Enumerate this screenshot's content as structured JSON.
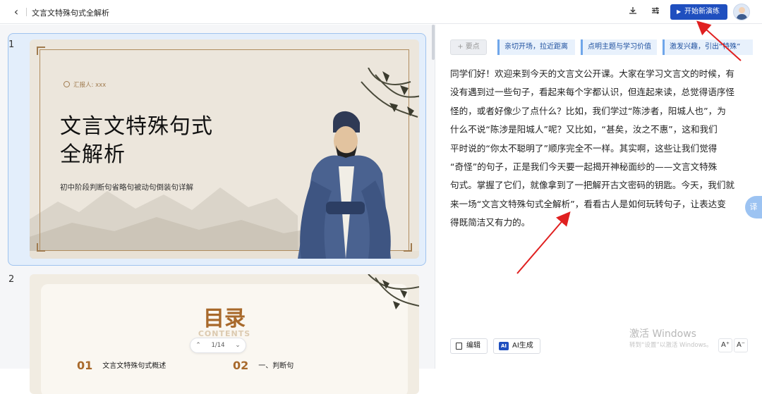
{
  "header": {
    "back_icon": "chevron-left-icon",
    "title": "文言文特殊句式全解析",
    "download_icon": "download-icon",
    "settings_icon": "sliders-icon",
    "start_button": "开始新演练",
    "accent": "#1f4fbf"
  },
  "slides": [
    {
      "number": "1",
      "reporter": "汇报人: xxx",
      "title_line1": "文言文特殊句式",
      "title_line2": "全解析",
      "subtitle": "初中阶段判断句省略句被动句倒装句详解"
    },
    {
      "number": "2",
      "title": "目录",
      "subtitle": "CONTENTS",
      "toc": [
        {
          "num": "01",
          "label": "文言文特殊句式概述"
        },
        {
          "num": "02",
          "label": "一、判断句"
        }
      ]
    }
  ],
  "pager": {
    "label": "1/14"
  },
  "notes": {
    "add_point": "+ 要点",
    "tags": [
      "亲切开场，拉近距离",
      "点明主题与学习价值",
      "激发兴趣，引出“特殊”"
    ],
    "lines": [
      "同学们好！欢迎来到今天的文言文公开课。大家在学习文言文的时候，有",
      "没有遇到过一些句子，看起来每个字都认识，但连起来读，总觉得语序怪",
      "怪的，或者好像少了点什么？比如，我们学过“陈涉者，阳城人也”，为",
      "什么不说“陈涉是阳城人”呢？又比如，“甚矣，汝之不惠”，这和我们",
      "平时说的“你太不聪明了”顺序完全不一样。其实啊，这些让我们觉得",
      "“奇怪”的句子，正是我们今天要一起揭开神秘面纱的——文言文特殊",
      "句式。掌握了它们，就像拿到了一把解开古文密码的钥匙。今天，我们就",
      "来一场“文言文特殊句式全解析”，看看古人是如何玩转句子，让表达变",
      "得既简洁又有力的。"
    ],
    "translate_tab": "译",
    "edit_button": "编辑",
    "ai_button": "AI生成",
    "ai_badge": "AI",
    "font_larger": "A⁺",
    "font_smaller": "A⁻"
  },
  "watermark": {
    "line1": "激活 Windows",
    "line2": "转到“设置”以激活 Windows。"
  }
}
